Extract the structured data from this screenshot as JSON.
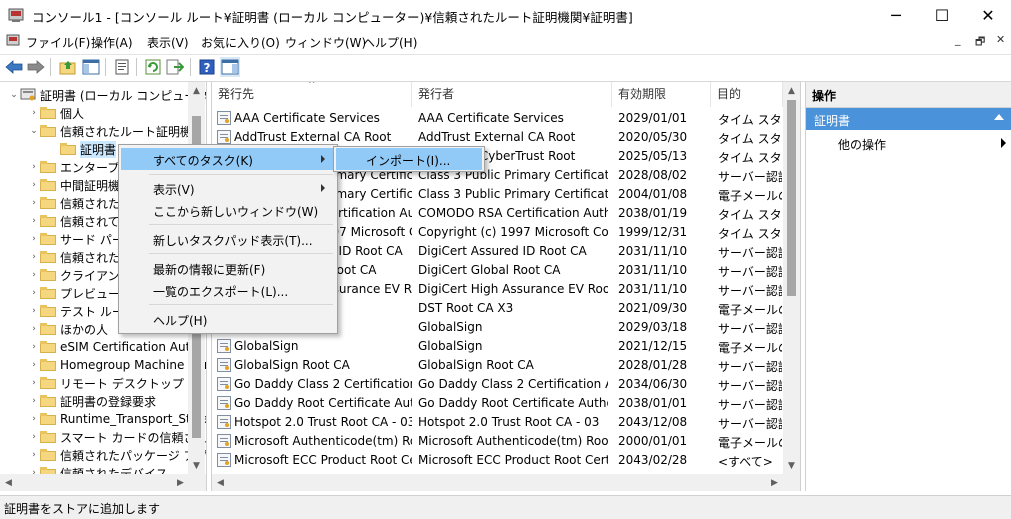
{
  "window": {
    "title": "コンソール1 - [コンソール ルート¥証明書 (ローカル コンピューター)¥信頼されたルート証明機関¥証明書]",
    "minimize_glyph": "─",
    "maximize_glyph": "☐",
    "close_glyph": "✕"
  },
  "menubar": {
    "items": [
      "ファイル(F)",
      "操作(A)",
      "表示(V)",
      "お気に入り(O)",
      "ウィンドウ(W)",
      "ヘルプ(H)"
    ],
    "mdi_min": "_",
    "mdi_restore": "🗗",
    "mdi_close": "✕"
  },
  "toolbar": {
    "icons": [
      "back-arrow-icon",
      "forward-arrow-icon",
      "up-folder-icon",
      "show-hide-tree-icon",
      "properties-icon",
      "refresh-icon",
      "export-list-icon",
      "help-icon",
      "show-hide-action-pane-icon"
    ]
  },
  "tree": {
    "root": "証明書 (ローカル コンピューター)",
    "items": [
      {
        "label": "個人",
        "depth": 1,
        "expanded": false
      },
      {
        "label": "信頼されたルート証明機関",
        "depth": 1,
        "expanded": true
      },
      {
        "label": "証明書",
        "depth": 2,
        "expanded": null,
        "selected": true
      },
      {
        "label": "エンタープライズの信頼",
        "depth": 1,
        "expanded": false
      },
      {
        "label": "中間証明機関",
        "depth": 1,
        "expanded": false
      },
      {
        "label": "信頼された発行元",
        "depth": 1,
        "expanded": false
      },
      {
        "label": "信頼されていない証明書",
        "depth": 1,
        "expanded": false
      },
      {
        "label": "サード パーティ ルート証明機関",
        "depth": 1,
        "expanded": false
      },
      {
        "label": "信頼された利用者",
        "depth": 1,
        "expanded": false
      },
      {
        "label": "クライアント認証発行者",
        "depth": 1,
        "expanded": false
      },
      {
        "label": "プレビュー ビルド ルート",
        "depth": 1,
        "expanded": false
      },
      {
        "label": "テスト ルート",
        "depth": 1,
        "expanded": false
      },
      {
        "label": "ほかの人",
        "depth": 1,
        "expanded": false
      },
      {
        "label": "eSIM Certification Authorities",
        "depth": 1,
        "expanded": false
      },
      {
        "label": "Homegroup Machine Certificates",
        "depth": 1,
        "expanded": false
      },
      {
        "label": "リモート デスクトップ",
        "depth": 1,
        "expanded": false
      },
      {
        "label": "証明書の登録要求",
        "depth": 1,
        "expanded": false
      },
      {
        "label": "Runtime_Transport_Store",
        "depth": 1,
        "expanded": false
      },
      {
        "label": "スマート カードの信頼されたルート",
        "depth": 1,
        "expanded": false
      },
      {
        "label": "信頼されたパッケージ アプリ",
        "depth": 1,
        "expanded": false
      },
      {
        "label": "信頼されたデバイス",
        "depth": 1,
        "expanded": false
      }
    ]
  },
  "list": {
    "columns": [
      "発行先",
      "発行者",
      "有効期限",
      "目的"
    ],
    "rows": [
      [
        "AAA Certificate Services",
        "AAA Certificate Services",
        "2029/01/01",
        "タイム スタンプ"
      ],
      [
        "AddTrust External CA Root",
        "AddTrust External CA Root",
        "2020/05/30",
        "タイム スタンプ"
      ],
      [
        "Baltimore CyberTrust Root",
        "Baltimore CyberTrust Root",
        "2025/05/13",
        "タイム スタンプ"
      ],
      [
        "Class 3 Public Primary Certificatio...",
        "Class 3 Public Primary Certificatio...",
        "2028/08/02",
        "サーバー認証,"
      ],
      [
        "Class 3 Public Primary Certificatio...",
        "Class 3 Public Primary Certificatio...",
        "2004/01/08",
        "電子メールの保"
      ],
      [
        "COMODO RSA Certification Aut...",
        "COMODO RSA Certification Auth...",
        "2038/01/19",
        "タイム スタンプ"
      ],
      [
        "Copyright (c) 1997 Microsoft Co...",
        "Copyright (c) 1997 Microsoft Corp.",
        "1999/12/31",
        "タイム スタンプ"
      ],
      [
        "DigiCert Assured ID Root CA",
        "DigiCert Assured ID Root CA",
        "2031/11/10",
        "サーバー認証,"
      ],
      [
        "DigiCert Global Root CA",
        "DigiCert Global Root CA",
        "2031/11/10",
        "サーバー認証,"
      ],
      [
        "DigiCert High Assurance EV Root ...",
        "DigiCert High Assurance EV Root ...",
        "2031/11/10",
        "サーバー認証,"
      ],
      [
        "DST Root CA X3",
        "DST Root CA X3",
        "2021/09/30",
        "電子メールの保"
      ],
      [
        "GlobalSign",
        "GlobalSign",
        "2029/03/18",
        "サーバー認証,"
      ],
      [
        "GlobalSign",
        "GlobalSign",
        "2021/12/15",
        "電子メールの保"
      ],
      [
        "GlobalSign Root CA",
        "GlobalSign Root CA",
        "2028/01/28",
        "サーバー認証,"
      ],
      [
        "Go Daddy Class 2 Certification ...",
        "Go Daddy Class 2 Certification Aut...",
        "2034/06/30",
        "サーバー認証,"
      ],
      [
        "Go Daddy Root Certificate Auth...",
        "Go Daddy Root Certificate Authori...",
        "2038/01/01",
        "サーバー認証,"
      ],
      [
        "Hotspot 2.0 Trust Root CA - 03",
        "Hotspot 2.0 Trust Root CA - 03",
        "2043/12/08",
        "サーバー認証,"
      ],
      [
        "Microsoft Authenticode(tm) Roo...",
        "Microsoft Authenticode(tm) Root ...",
        "2000/01/01",
        "電子メールの保"
      ],
      [
        "Microsoft ECC Product Root Cer...",
        "Microsoft ECC Product Root Certif...",
        "2043/02/28",
        "<すべて>"
      ]
    ]
  },
  "actions": {
    "header": "操作",
    "selected": "証明書",
    "other": "他の操作"
  },
  "context_menu": {
    "items": [
      "すべてのタスク(K)",
      "表示(V)",
      "ここから新しいウィンドウ(W)",
      "新しいタスクパッド表示(T)...",
      "最新の情報に更新(F)",
      "一覧のエクスポート(L)...",
      "ヘルプ(H)"
    ],
    "submenu": [
      "インポート(I)..."
    ]
  },
  "status": {
    "text": "証明書をストアに追加します"
  }
}
